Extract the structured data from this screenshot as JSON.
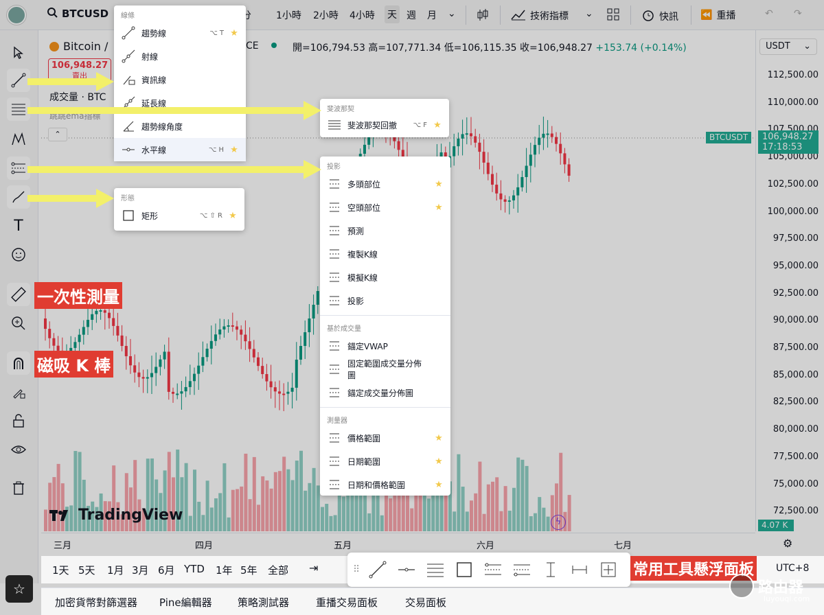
{
  "top": {
    "symbol": "BTCUSD",
    "timeframes": [
      "30分",
      "1小時",
      "2小時",
      "4小時",
      "天",
      "週",
      "月"
    ],
    "active_tf": "天",
    "indicators_label": "技術指標",
    "alert_label": "快訊",
    "replay_label": "重播"
  },
  "legend": {
    "title": "Bitcoin /",
    "title_tail": "CE",
    "ohlc_open": "開=106,794.53",
    "ohlc_high": "高=107,771.34",
    "ohlc_low": "低=106,115.35",
    "ohlc_close": "收=106,948.27",
    "change": "+153.74 (+0.14%)",
    "sell_price": "106,948.27",
    "sell_label": "賣出",
    "volume": "成交量 · BTC",
    "sub": "跳跳ema指標"
  },
  "currency": "USDT",
  "price_axis": [
    "112,500.00",
    "110,000.00",
    "107,500.00",
    "105,000.00",
    "102,500.00",
    "100,000.00",
    "97,500.00",
    "95,000.00",
    "92,500.00",
    "90,000.00",
    "87,500.00",
    "85,000.00",
    "82,500.00",
    "80,000.00",
    "77,500.00",
    "75,000.00",
    "72,500.00"
  ],
  "current_tag": "BTCUSDT",
  "current_price": "106,948.27",
  "current_time": "17:18:53",
  "volume_tag": "4.07 K",
  "time_axis": [
    "三月",
    "四月",
    "五月",
    "六月",
    "七月"
  ],
  "brand": "TradingView",
  "ranges": [
    "1天",
    "5天",
    "1月",
    "3月",
    "6月",
    "YTD",
    "1年",
    "5年",
    "全部"
  ],
  "utc": "UTC+8",
  "tabs": [
    "加密貨幣對篩選器",
    "Pine編輯器",
    "策略測試器",
    "重播交易面板",
    "交易面板"
  ],
  "popup_lines": {
    "section": "線條",
    "items": [
      {
        "label": "趨勢線",
        "shortcut": "⌥ T",
        "star": true
      },
      {
        "label": "射線",
        "shortcut": "",
        "star": false
      },
      {
        "label": "資訊線",
        "shortcut": "",
        "star": false
      },
      {
        "label": "延長線",
        "shortcut": "",
        "star": false
      },
      {
        "label": "趨勢線角度",
        "shortcut": "",
        "star": false
      },
      {
        "label": "水平線",
        "shortcut": "⌥ H",
        "star": true
      }
    ]
  },
  "popup_shapes": {
    "section": "形態",
    "items": [
      {
        "label": "矩形",
        "shortcut": "⌥ ⇧ R",
        "star": true
      }
    ]
  },
  "popup_fib": {
    "section": "斐波那契",
    "items": [
      {
        "label": "斐波那契回撤",
        "shortcut": "⌥ F",
        "star": true
      }
    ]
  },
  "popup_proj": {
    "sections": [
      {
        "title": "投影",
        "items": [
          {
            "label": "多頭部位",
            "star": true
          },
          {
            "label": "空頭部位",
            "star": true
          },
          {
            "label": "預測",
            "star": false
          },
          {
            "label": "複製K線",
            "star": false
          },
          {
            "label": "模擬K線",
            "star": false
          },
          {
            "label": "投影",
            "star": false
          }
        ]
      },
      {
        "title": "基於成交量",
        "items": [
          {
            "label": "錨定VWAP",
            "star": false
          },
          {
            "label": "固定範圍成交量分佈圖",
            "star": false
          },
          {
            "label": "錨定成交量分佈圖",
            "star": false
          }
        ]
      },
      {
        "title": "測量器",
        "items": [
          {
            "label": "價格範圍",
            "star": true
          },
          {
            "label": "日期範圍",
            "star": true
          },
          {
            "label": "日期和價格範圍",
            "star": true
          }
        ]
      }
    ]
  },
  "annotations": {
    "measure": "一次性測量",
    "magnet": "磁吸 K 棒",
    "floating": "常用工具懸浮面板"
  },
  "watermark": {
    "name": "路由器",
    "url": "luyouqi.com"
  },
  "colors": {
    "up": "#089981",
    "down": "#f23645",
    "accent": "#22ab94",
    "arrow": "#f3f06a",
    "annot": "#e03c31"
  }
}
